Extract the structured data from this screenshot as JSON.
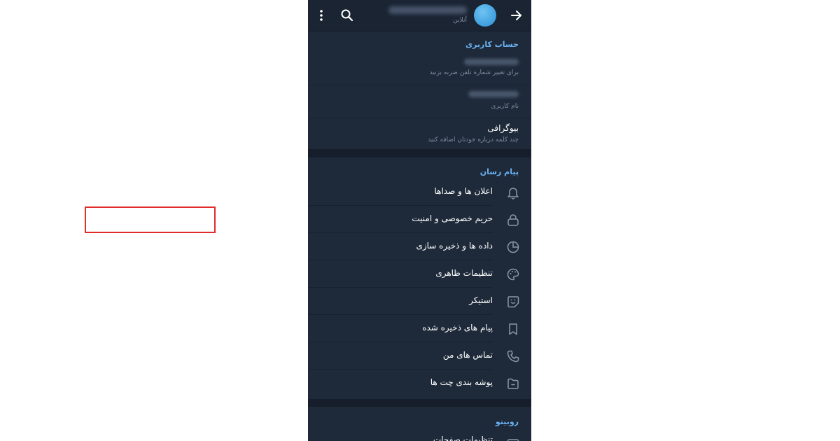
{
  "header": {
    "status": "آنلاین"
  },
  "account": {
    "title": "حساب کاربری",
    "phone_hint": "برای تغییر شماره تلفن ضربه بزنید",
    "username_hint": "نام کاربری",
    "bio_label": "بیوگرافی",
    "bio_hint": "چند کلمه درباره خودتان اضافه کنید"
  },
  "messenger": {
    "title": "پیام رسان",
    "items": [
      {
        "label": "اعلان ها و صداها",
        "icon": "bell-icon"
      },
      {
        "label": "حریم خصوصی و امنیت",
        "icon": "lock-icon"
      },
      {
        "label": "داده ها و ذخیره سازی",
        "icon": "pie-chart-icon"
      },
      {
        "label": "تنظیمات ظاهری",
        "icon": "palette-icon"
      },
      {
        "label": "استیکر",
        "icon": "sticker-icon"
      },
      {
        "label": "پیام های ذخیره شده",
        "icon": "bookmark-icon"
      },
      {
        "label": "تماس های من",
        "icon": "phone-icon"
      },
      {
        "label": "پوشه بندی چت ها",
        "icon": "folder-icon"
      }
    ]
  },
  "rubino": {
    "title": "روبینو",
    "partial_item": "تنظیمات صفحات"
  },
  "colors": {
    "background": "#1e2a3a",
    "accent": "#6ab2f2",
    "highlight": "#e32b2b"
  }
}
